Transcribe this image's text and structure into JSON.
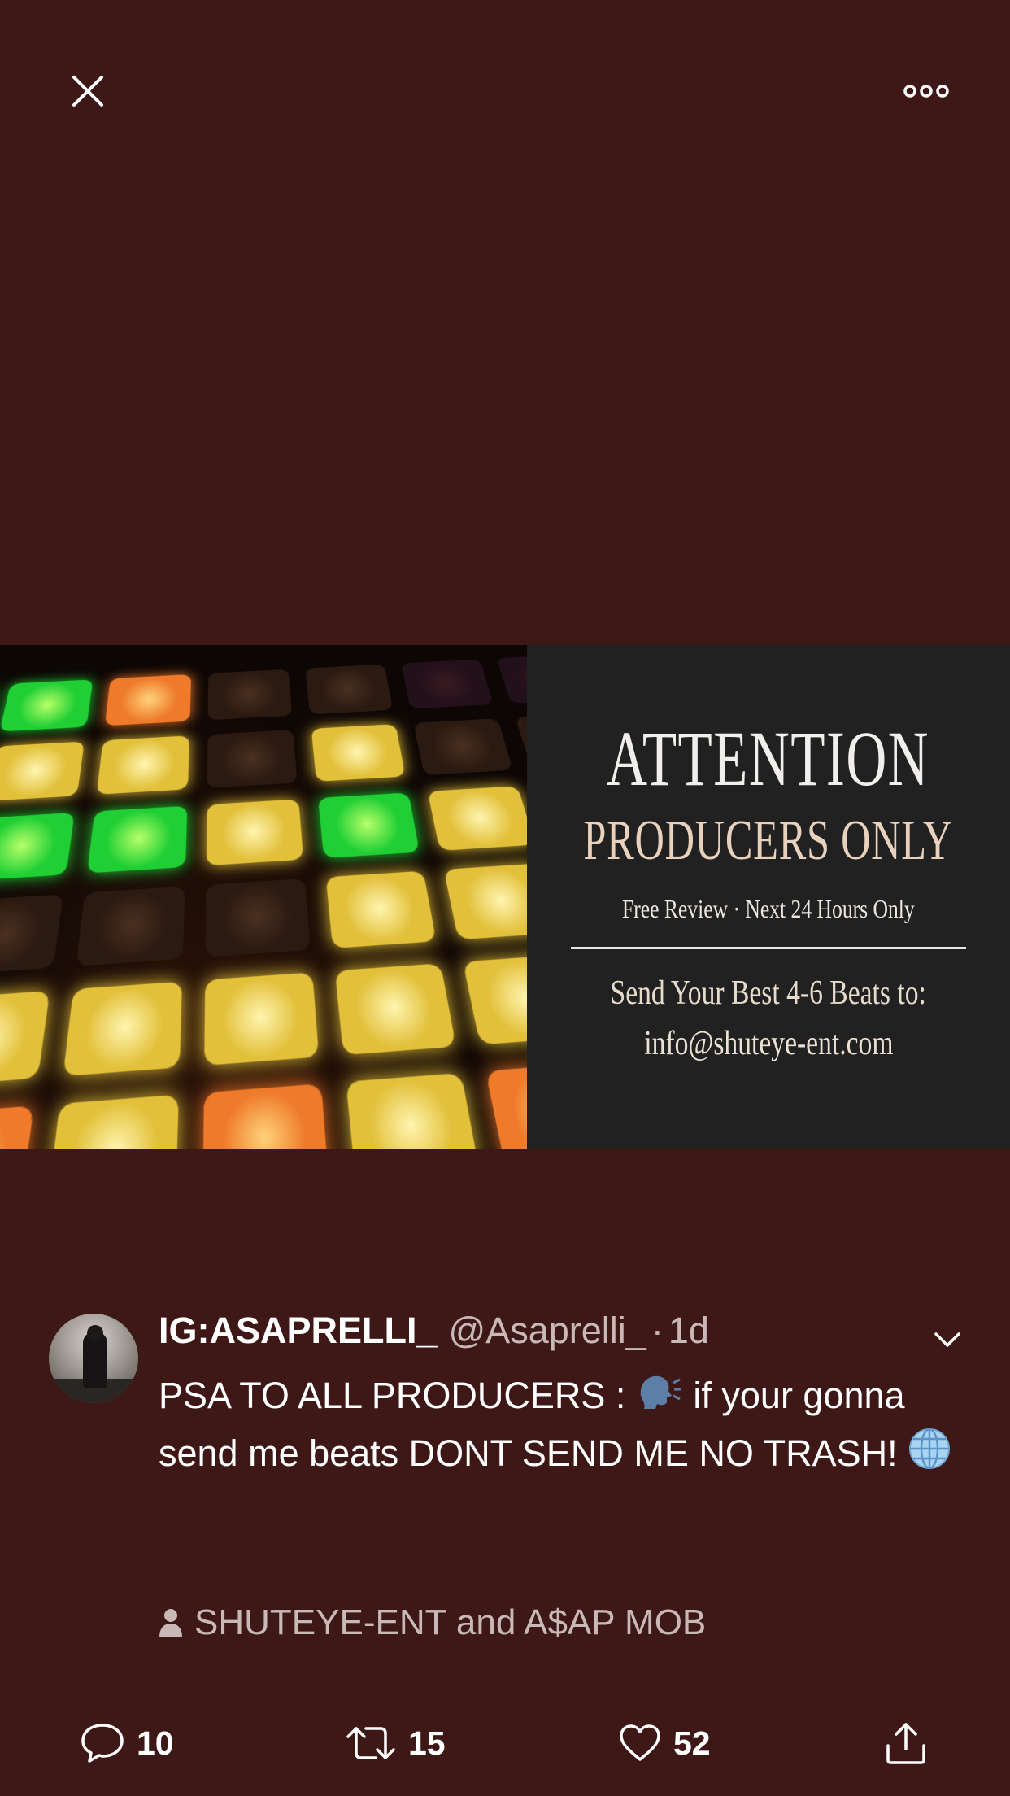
{
  "topbar": {
    "close_icon": "close-icon",
    "more_icon": "more-horizontal-icon"
  },
  "media": {
    "poster": {
      "headline": "ATTENTION",
      "subhead": "PRODUCERS ONLY",
      "tagline": "Free Review · Next 24 Hours Only",
      "cta": "Send Your Best 4-6 Beats to:",
      "email": "info@shuteye-ent.com"
    }
  },
  "tweet": {
    "display_name": "IG:ASAPRELLI_",
    "handle": "@Asaprelli_",
    "separator": "·",
    "time": "1d",
    "text_part1": "PSA TO ALL PRODUCERS : ",
    "text_part2": " if your gonna send me beats DONT SEND ME NO TRASH! ",
    "tagged": "SHUTEYE-ENT and A$AP MOB"
  },
  "actions": {
    "replies": "10",
    "retweets": "15",
    "likes": "52"
  },
  "colors": {
    "background": "#3e1816",
    "secondary_text": "#c9b9b6"
  }
}
